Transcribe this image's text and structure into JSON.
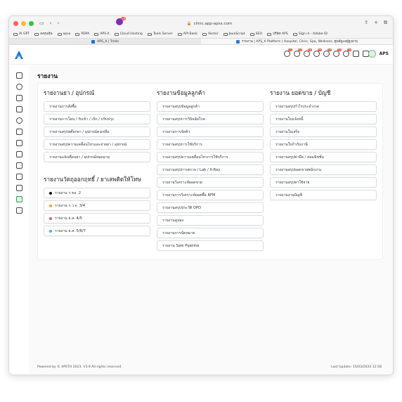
{
  "browser": {
    "url": "clinic.app-apsx.com",
    "notification_badge": "19",
    "bookmarks": [
      "AI GPT",
      "ลงทุนหุ้น",
      "apsx",
      "PDPA",
      "APS-X",
      "Cloud Hosting",
      "Tools Server",
      "API Bank",
      "Vector",
      "JavaScript",
      "SEO",
      "บริษัท APS",
      "Sign in - Adobe ID"
    ],
    "tabs": [
      {
        "label": "APS_X | Trello",
        "active": false
      },
      {
        "label": "รายงาน | APS_X Platform | Hospital, Clinic, Spa, Wellness, ศูนย์ดูแลผู้สูงอายุ",
        "active": true
      }
    ]
  },
  "header": {
    "username": "APS",
    "badges": [
      "10",
      "43",
      "56",
      "99",
      "99",
      "35",
      "70"
    ]
  },
  "page": {
    "title": "รายงาน"
  },
  "columns": {
    "products": {
      "title": "รายงานยา / อุปกรณ์",
      "items": [
        "รายงานการสั่งซื้อ",
        "รายงานการโอน / รับเข้า / เบิก / ปรับปรุง",
        "รายงานสรุปสต๊อกยา / อุปกรณ์คงเหลือ",
        "รายงานสรุปความเคลื่อนไหวและจ่ายยา / อุปกรณ์",
        "รายงานแจ้งเตือนยา / อุปกรณ์หมดอายุ"
      ]
    },
    "narcotics": {
      "title": "รายงานวัตถุออกฤทธิ์ / ยาเสพติดให้โทษ",
      "items": [
        {
          "label": "รายงาน ร.ขจ. 2",
          "color": "#111111"
        },
        {
          "label": "รายงาน ร.ว.จ. 3/4",
          "color": "#f39c4a"
        },
        {
          "label": "รายงาน ย.ส. 4/5",
          "color": "#e85a6b"
        },
        {
          "label": "รายงาน ย.ส. 5/6/7",
          "color": "#2bc0cf"
        }
      ]
    },
    "customers": {
      "title": "รายงานข้อมูลลูกค้า",
      "items": [
        "รายงานสรุปข้อมูลลูกค้า",
        "รายงานสรุปการวินิจฉัยโรค",
        "รายงานการจัดคิว",
        "รายงานสรุปการใช้บริการ",
        "รายงานสรุปความเคลื่อนไหวการใช้บริการ",
        "รายงานสรุปการตรวจ / Lab / X-Ray",
        "รายงานวิเคราะห์ยอดขาย",
        "รายงานการวิเคราะห์ยอดซื้อ RFM",
        "รายงานสรุปประวัติ OPD",
        "รายงานคูปอง",
        "รายงานการนัดหมาย",
        "รายงาน Sale Pipeline"
      ]
    },
    "sales": {
      "title": "รายงาน ยอดขาย / บัญชี",
      "items": [
        "รายงานสรุปกำไรประจำงวด",
        "รายงานใบแจ้งหนี้",
        "รายงานใบเสร็จ",
        "รายงานใบกำกับภาษี",
        "รายงานสรุปค่ามือ / คอมมิชชั่น",
        "รายงานสรุปยอดขายพนักงาน",
        "รายงานสรุปค่าใช้จ่าย",
        "รายงานงานบัญชี"
      ]
    }
  },
  "footer": {
    "left": "Powered by © APSTH 2023. V3.9 All rights reserved.",
    "right": "Last Update: 15/03/2024 12:58"
  },
  "colors": {
    "accent": "#2d9b5a",
    "logo": "#1e6fd9"
  }
}
